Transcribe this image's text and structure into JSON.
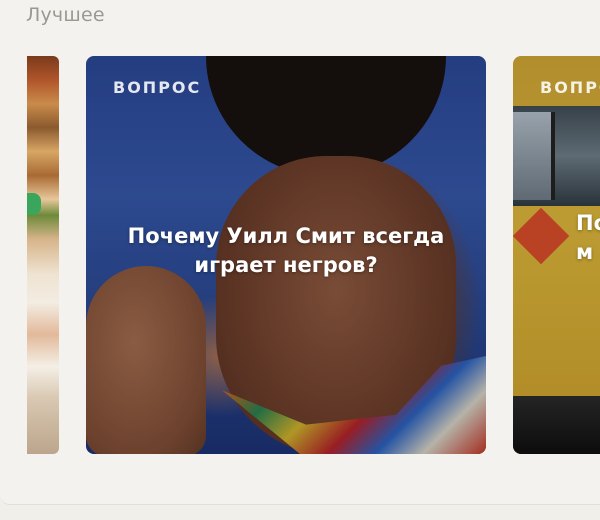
{
  "section": {
    "title": "Лучшее"
  },
  "cards": [
    {
      "tag": "",
      "title": "",
      "image": "food-photo"
    },
    {
      "tag": "ВОПРОС",
      "title": "Почему Уилл Смит всегда играет негров?",
      "image": "man-smiling-photo"
    },
    {
      "tag": "ВОПРОС",
      "title": "По",
      "secondary_title_fragment": "м",
      "image": "yellow-bus-photo"
    }
  ],
  "colors": {
    "background": "#f4f2ee",
    "section_title": "#9b9892",
    "card_text": "#ffffff"
  }
}
